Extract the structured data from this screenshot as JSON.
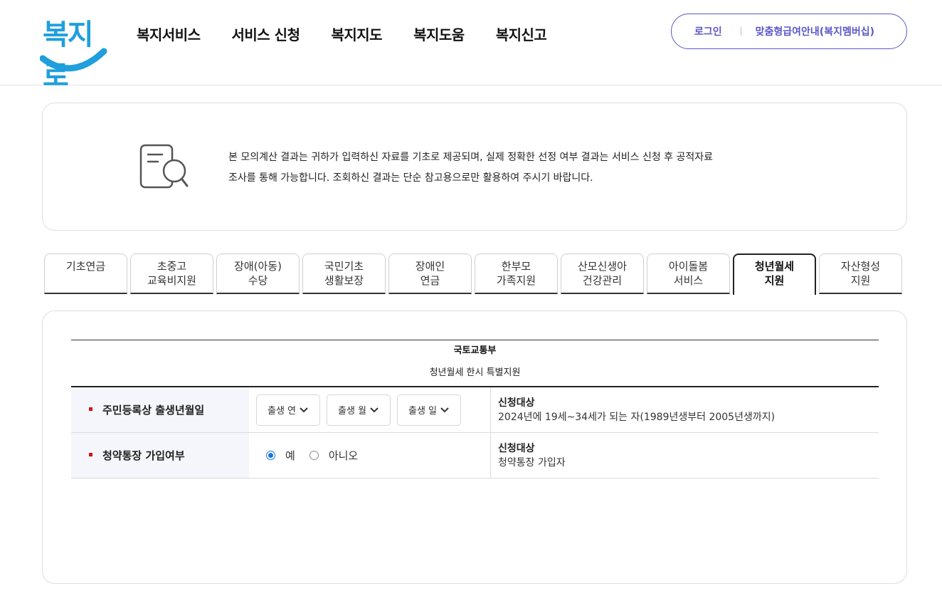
{
  "header": {
    "logo_text": "복지로",
    "nav": [
      "복지서비스",
      "서비스 신청",
      "복지지도",
      "복지도움",
      "복지신고"
    ],
    "login_label": "로그인",
    "benefit_label": "맞춤형급여안내(복지멤버십)"
  },
  "notice": {
    "icon": "document-search-icon",
    "line1": "본 모의계산 결과는 귀하가 입력하신 자료를 기초로 제공되며, 실제 정확한 선정 여부 결과는 서비스 신청 후 공적자료",
    "line2": "조사를 통해 가능합니다. 조회하신 결과는 단순 참고용으로만 활용하여 주시기 바랍니다."
  },
  "tabs": [
    {
      "label": "기초연금",
      "active": false
    },
    {
      "label": "초중고\n교육비지원",
      "active": false
    },
    {
      "label": "장애(아동)\n수당",
      "active": false
    },
    {
      "label": "국민기초\n생활보장",
      "active": false
    },
    {
      "label": "장애인\n연금",
      "active": false
    },
    {
      "label": "한부모\n가족지원",
      "active": false
    },
    {
      "label": "산모신생아\n건강관리",
      "active": false
    },
    {
      "label": "아이돌봄\n서비스",
      "active": false
    },
    {
      "label": "청년월세\n지원",
      "active": true
    },
    {
      "label": "자산형성\n지원",
      "active": false
    }
  ],
  "panel": {
    "ministry": "국토교통부",
    "program": "청년월세 한시 특별지원",
    "rows": [
      {
        "label": "주민등록상 출생년월일",
        "selects": [
          "출생 연",
          "출생 월",
          "출생 일"
        ],
        "info_title": "신청대상",
        "info_desc": "2024년에 19세~34세가 되는 자(1989년생부터 2005년생까지)"
      },
      {
        "label": "청약통장 가입여부",
        "radio_yes": "예",
        "radio_no": "아니오",
        "selected": "예",
        "info_title": "신청대상",
        "info_desc": "청약통장 가입자"
      }
    ]
  },
  "colors": {
    "brand_blue": "#1f9fdd",
    "accent_purple": "#5b57c8",
    "bullet_red": "#d2141a"
  }
}
